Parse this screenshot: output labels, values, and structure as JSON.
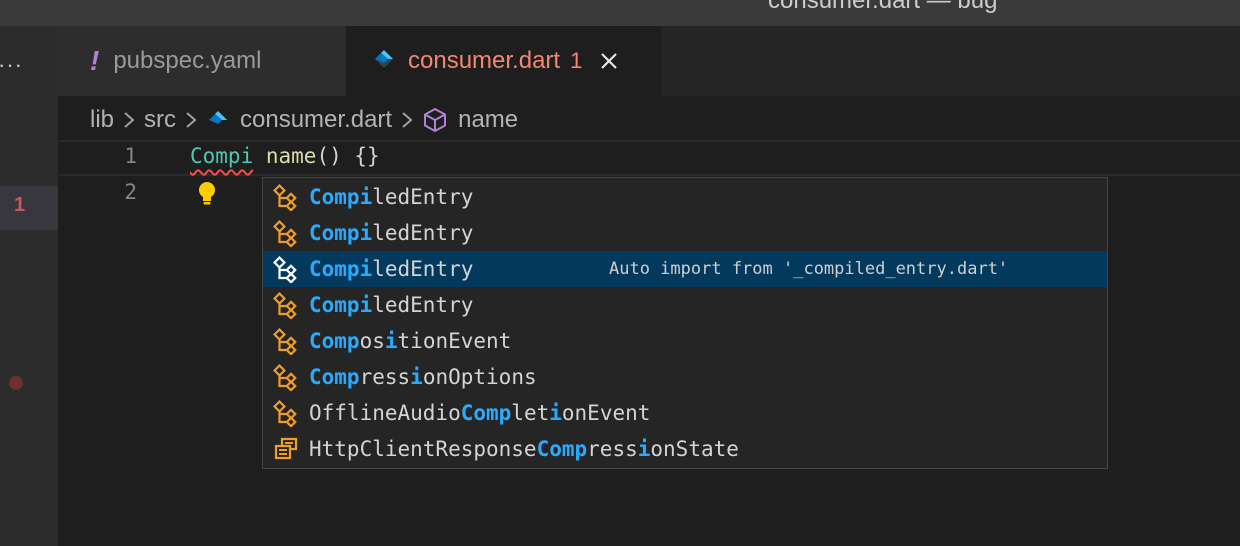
{
  "window": {
    "title": "consumer.dart — bug"
  },
  "activity_bar": {
    "more_label": "···",
    "badge": "1"
  },
  "tabs": [
    {
      "label": "pubspec.yaml",
      "icon": "yaml-exclamation-icon"
    },
    {
      "label": "consumer.dart",
      "icon": "dart-icon",
      "problems": "1",
      "active": true
    }
  ],
  "breadcrumb": {
    "items": [
      "lib",
      "src",
      "consumer.dart",
      "name"
    ]
  },
  "editor": {
    "line_numbers": [
      "1",
      "2"
    ],
    "line1": {
      "class_token": "Compi",
      "function": "name",
      "rest": "() {}"
    }
  },
  "suggestions": [
    {
      "parts": [
        {
          "t": "Compi",
          "h": true
        },
        {
          "t": "ledEntry",
          "h": false
        }
      ],
      "icon": "class-icon",
      "detail": ""
    },
    {
      "parts": [
        {
          "t": "Compi",
          "h": true
        },
        {
          "t": "ledEntry",
          "h": false
        }
      ],
      "icon": "class-icon",
      "detail": ""
    },
    {
      "parts": [
        {
          "t": "Compi",
          "h": true
        },
        {
          "t": "ledEntry",
          "h": false
        }
      ],
      "icon": "class-icon",
      "detail": "Auto import from '_compiled_entry.dart'",
      "selected": true
    },
    {
      "parts": [
        {
          "t": "Compi",
          "h": true
        },
        {
          "t": "ledEntry",
          "h": false
        }
      ],
      "icon": "class-icon",
      "detail": ""
    },
    {
      "parts": [
        {
          "t": "Comp",
          "h": true
        },
        {
          "t": "os",
          "h": false
        },
        {
          "t": "i",
          "h": true
        },
        {
          "t": "tionEvent",
          "h": false
        }
      ],
      "icon": "class-icon",
      "detail": ""
    },
    {
      "parts": [
        {
          "t": "Comp",
          "h": true
        },
        {
          "t": "ress",
          "h": false
        },
        {
          "t": "i",
          "h": true
        },
        {
          "t": "onOptions",
          "h": false
        }
      ],
      "icon": "class-icon",
      "detail": ""
    },
    {
      "parts": [
        {
          "t": "OfflineAudio",
          "h": false
        },
        {
          "t": "Comp",
          "h": true
        },
        {
          "t": "let",
          "h": false
        },
        {
          "t": "i",
          "h": true
        },
        {
          "t": "onEvent",
          "h": false
        }
      ],
      "icon": "class-icon",
      "detail": ""
    },
    {
      "parts": [
        {
          "t": "HttpClientResponse",
          "h": false
        },
        {
          "t": "Comp",
          "h": true
        },
        {
          "t": "ress",
          "h": false
        },
        {
          "t": "i",
          "h": true
        },
        {
          "t": "onState",
          "h": false
        }
      ],
      "icon": "enum-icon",
      "detail": ""
    }
  ],
  "colors": {
    "accent": "#2aaaff",
    "error": "#f48771",
    "selection": "#04395e"
  }
}
